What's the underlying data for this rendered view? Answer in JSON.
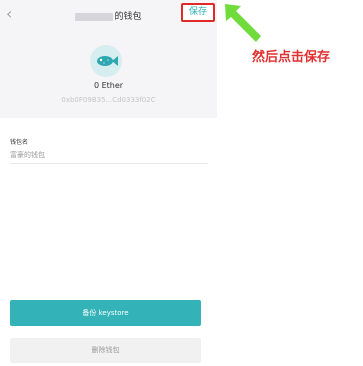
{
  "header": {
    "title_suffix": "的钱包",
    "save_label": "保存"
  },
  "wallet": {
    "balance": "0 Ether",
    "address": "0xb0F09B35...Cd0333f02C"
  },
  "form": {
    "label": "钱包名",
    "value": "富豪的钱包"
  },
  "buttons": {
    "backup": "备份 keystore",
    "delete": "删除钱包"
  },
  "annotation": "然后点击保存",
  "colors": {
    "accent": "#33b3b8",
    "highlight": "#e02a2a",
    "arrow": "#6fdc3c"
  },
  "icons": {
    "back": "chevron-left-icon",
    "avatar": "fish-icon",
    "pointer": "arrow-icon"
  }
}
